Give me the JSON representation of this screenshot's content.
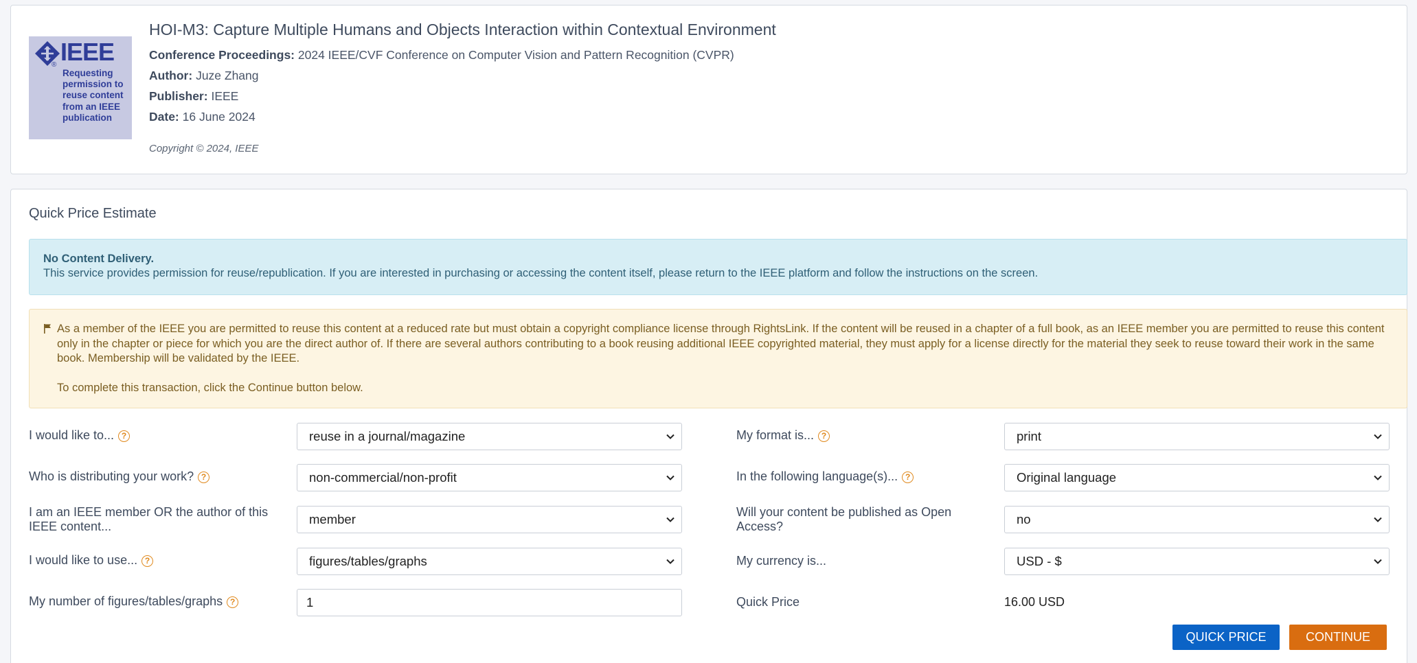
{
  "header": {
    "logo": {
      "brand": "IEEE",
      "text": "Requesting permission to reuse content from an IEEE publication"
    },
    "title": "HOI-M3: Capture Multiple Humans and Objects Interaction within Contextual Environment",
    "conference_label": "Conference Proceedings:",
    "conference_value": "2024 IEEE/CVF Conference on Computer Vision and Pattern Recognition (CVPR)",
    "author_label": "Author:",
    "author_value": "Juze Zhang",
    "publisher_label": "Publisher:",
    "publisher_value": "IEEE",
    "date_label": "Date:",
    "date_value": "16 June 2024",
    "copyright": "Copyright © 2024, IEEE"
  },
  "estimate": {
    "title": "Quick Price Estimate",
    "info_heading": "No Content Delivery.",
    "info_text": "This service provides permission for reuse/republication. If you are interested in purchasing or accessing the content itself, please return to the IEEE platform and follow the instructions on the screen.",
    "warn_text": "As a member of the IEEE you are permitted to reuse this content at a reduced rate but must obtain a copyright compliance license through RightsLink. If the content will be reused in a chapter of a full book, as an IEEE member you are permitted to reuse this content only in the chapter or piece for which you are the direct author of. If there are several authors contributing to a book reusing additional IEEE copyrighted material, they must apply for a license directly for the material they seek to reuse toward their work in the same book. Membership will be validated by the IEEE.",
    "warn_continue": "To complete this transaction, click the Continue button below.",
    "fields": {
      "would_like_label": "I would like to...",
      "would_like_value": "reuse in a journal/magazine",
      "distributing_label": "Who is distributing your work?",
      "distributing_value": "non-commercial/non-profit",
      "member_label": "I am an IEEE member OR the author of this IEEE content...",
      "member_value": "member",
      "use_label": "I would like to use...",
      "use_value": "figures/tables/graphs",
      "number_label": "My number of figures/tables/graphs",
      "number_value": "1",
      "format_label": "My format is...",
      "format_value": "print",
      "language_label": "In the following language(s)...",
      "language_value": "Original language",
      "open_access_label": "Will your content be published as Open Access?",
      "open_access_value": "no",
      "currency_label": "My currency is...",
      "currency_value": "USD - $",
      "quick_price_label": "Quick Price",
      "quick_price_value": "16.00 USD"
    },
    "help_glyph": "?",
    "buttons": {
      "quick_price": "QUICK PRICE",
      "continue": "CONTINUE"
    }
  },
  "colors": {
    "quick_button": "#0b63c6",
    "continue_button": "#d96d10",
    "help_icon": "#e08a1f",
    "info_bg": "#d7eef5",
    "warn_bg": "#fdf5e2"
  }
}
